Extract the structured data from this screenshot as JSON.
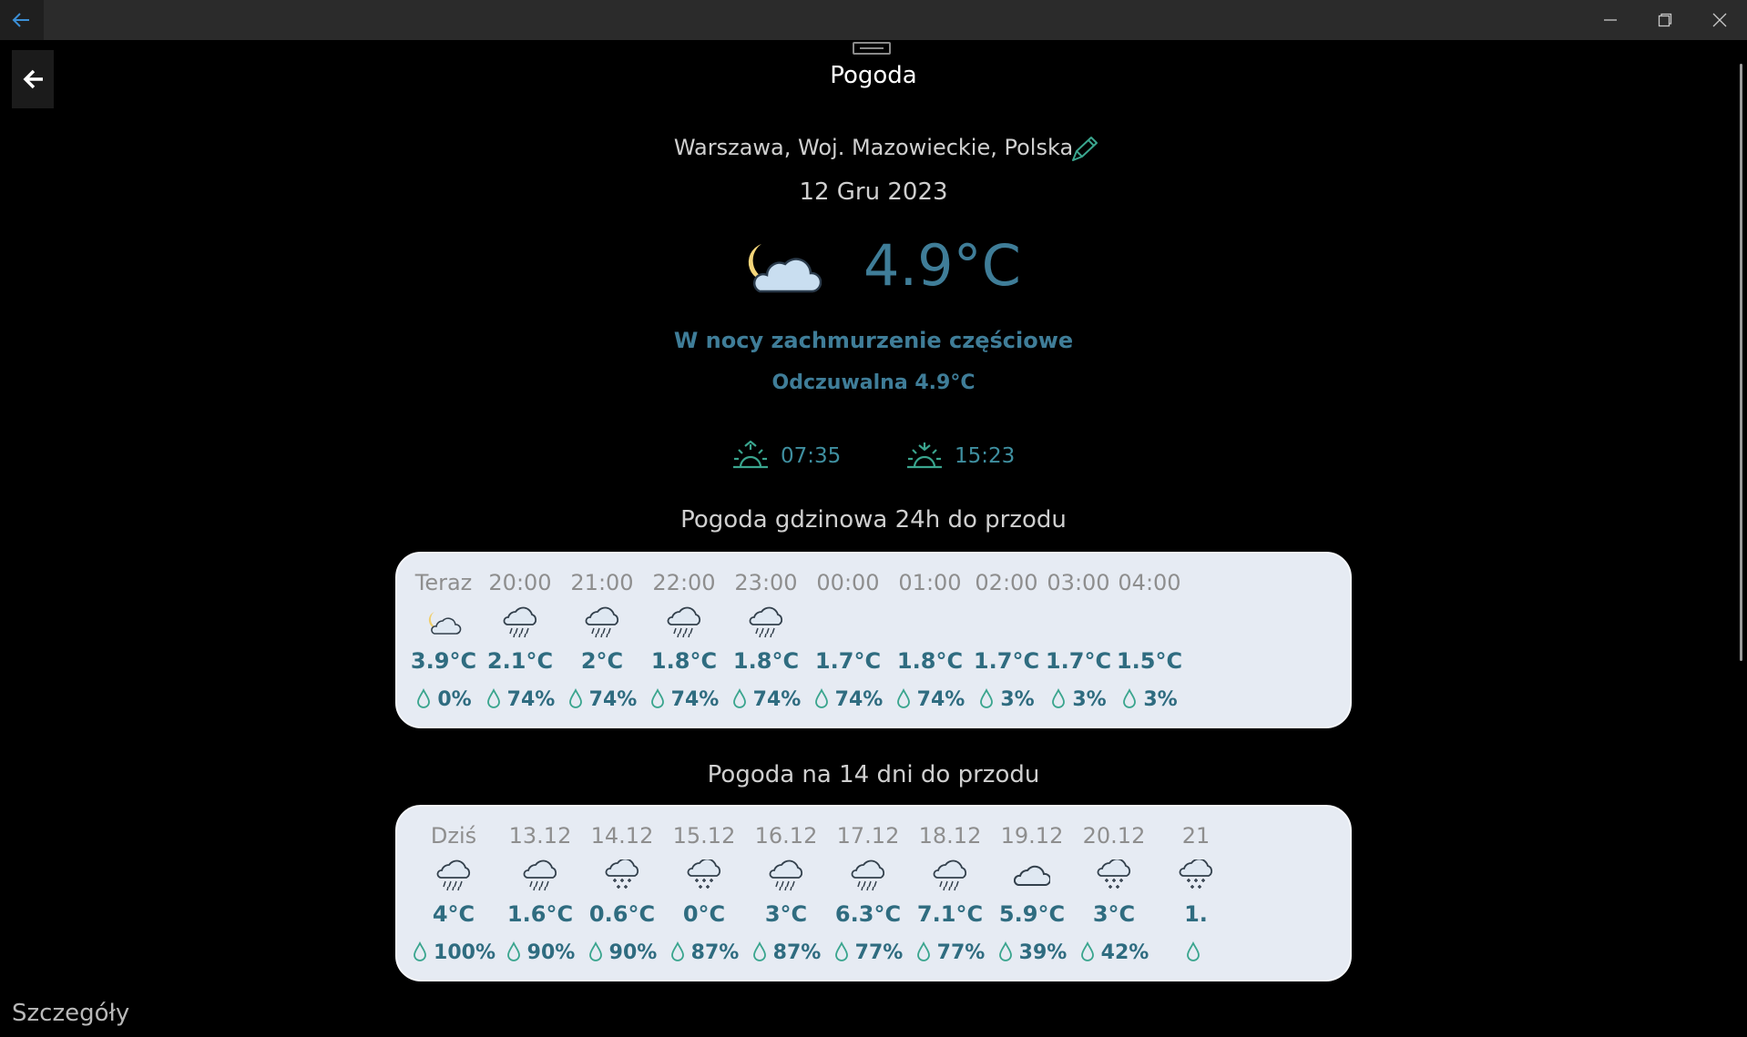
{
  "window": {
    "controls": [
      "minimize",
      "restore",
      "close"
    ]
  },
  "header": {
    "title": "Pogoda"
  },
  "current": {
    "location": "Warszawa, Woj. Mazowieckie, Polska",
    "date": "12 Gru 2023",
    "temperature": "4.9°C",
    "description": "W nocy zachmurzenie częściowe",
    "feels_like": "Odczuwalna 4.9°C",
    "sunrise": "07:35",
    "sunset": "15:23",
    "icon": "night-partly-cloudy-icon"
  },
  "hourly": {
    "title": "Pogoda gdzinowa 24h do przodu",
    "items": [
      {
        "label": "Teraz",
        "temp": "3.9°C",
        "precip": "0%",
        "icon": "night-partly-cloudy-icon"
      },
      {
        "label": "20:00",
        "temp": "2.1°C",
        "precip": "74%",
        "icon": "rain-icon"
      },
      {
        "label": "21:00",
        "temp": "2°C",
        "precip": "74%",
        "icon": "rain-icon"
      },
      {
        "label": "22:00",
        "temp": "1.8°C",
        "precip": "74%",
        "icon": "rain-icon"
      },
      {
        "label": "23:00",
        "temp": "1.8°C",
        "precip": "74%",
        "icon": "rain-icon"
      },
      {
        "label": "00:00",
        "temp": "1.7°C",
        "precip": "74%",
        "icon": "none"
      },
      {
        "label": "01:00",
        "temp": "1.8°C",
        "precip": "74%",
        "icon": "none"
      },
      {
        "label": "02:00",
        "temp": "1.7°C",
        "precip": "3%",
        "icon": "none"
      },
      {
        "label": "03:00",
        "temp": "1.7°C",
        "precip": "3%",
        "icon": "none"
      },
      {
        "label": "04:00",
        "temp": "1.5°C",
        "precip": "3%",
        "icon": "none"
      }
    ]
  },
  "daily": {
    "title": "Pogoda na 14 dni do przodu",
    "items": [
      {
        "label": "Dziś",
        "temp": "4°C",
        "precip": "100%",
        "icon": "rain-icon"
      },
      {
        "label": "13.12",
        "temp": "1.6°C",
        "precip": "90%",
        "icon": "rain-icon"
      },
      {
        "label": "14.12",
        "temp": "0.6°C",
        "precip": "90%",
        "icon": "sleet-icon"
      },
      {
        "label": "15.12",
        "temp": "0°C",
        "precip": "87%",
        "icon": "sleet-icon"
      },
      {
        "label": "16.12",
        "temp": "3°C",
        "precip": "87%",
        "icon": "rain-icon"
      },
      {
        "label": "17.12",
        "temp": "6.3°C",
        "precip": "77%",
        "icon": "rain-icon"
      },
      {
        "label": "18.12",
        "temp": "7.1°C",
        "precip": "77%",
        "icon": "rain-icon"
      },
      {
        "label": "19.12",
        "temp": "5.9°C",
        "precip": "39%",
        "icon": "cloud-icon"
      },
      {
        "label": "20.12",
        "temp": "3°C",
        "precip": "42%",
        "icon": "sleet-icon"
      },
      {
        "label": "21",
        "temp": "1.",
        "precip": "",
        "icon": "sleet-icon"
      }
    ]
  },
  "footer": {
    "label": "Szczegóły"
  },
  "colors": {
    "accent": "#3f7d98",
    "panel": "#e6ebf3",
    "sun_icon": "#3aa58e"
  }
}
